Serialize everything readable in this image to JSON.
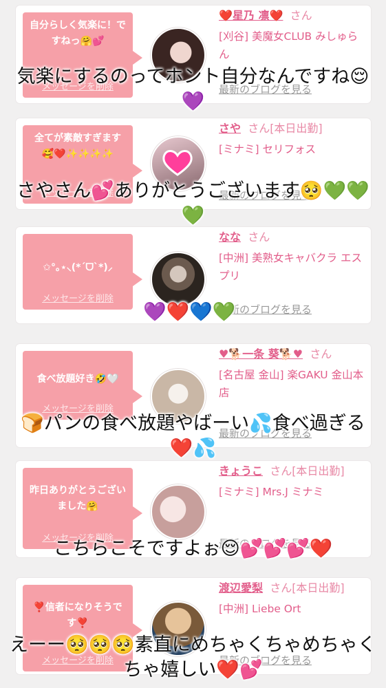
{
  "cards": [
    {
      "message": "自分らしく気楽に！ですねっ🤗💕",
      "delete_label": "メッセージを削除",
      "name": "❤️星乃 凛❤️",
      "honorific": "さん",
      "shop": "[刈谷] 美魔女CLUB みしゅらん",
      "blog_link": "最新のブログを見る",
      "avatar_colors": [
        "#e9ccc4",
        "#3a2522"
      ]
    },
    {
      "message": "全てが素敵すぎます🥰❤️✨✨✨✨",
      "delete_label": "メッセージを削除",
      "name": "さや",
      "honorific": "さん[本日出勤]",
      "shop": "[ミナミ] セリフォス",
      "blog_link": "最新のブログを見る",
      "avatar_colors": [
        "#d9b8c0",
        "#8a6a70"
      ]
    },
    {
      "message": "✩°｡⋆⸜(*ˊᗜˋ*)⸝",
      "delete_label": "メッセージを削除",
      "name": "なな",
      "honorific": "さん",
      "shop": "[中洲] 美熟女キャバクラ エスプリ",
      "blog_link": "最新のブログを見る",
      "avatar_colors": [
        "#d4c7bd",
        "#2b241f"
      ]
    },
    {
      "message": "食べ放題好き🤣🤍",
      "delete_label": "メッセージを削除",
      "name": "♥🐕一条 葵🐕♥",
      "honorific": "さん",
      "shop": "[名古屋 金山] 楽GAKU 金山本店",
      "blog_link": "最新のブログを見る",
      "avatar_colors": [
        "#f2ede8",
        "#c9b7a6"
      ]
    },
    {
      "message": "昨日ありがとうございました🤗",
      "delete_label": "メッセージを削除",
      "name": "きょうこ",
      "honorific": "さん[本日出勤]",
      "shop": "[ミナミ] Mrs.J ミナミ",
      "blog_link": "最新のブログを見る",
      "avatar_colors": [
        "#f3dcdb",
        "#c79f9c"
      ]
    },
    {
      "message": "❣️信者になりそうです❣️",
      "delete_label": "メッセージを削除",
      "name": "渡辺愛梨",
      "honorific": "さん[本日出勤]",
      "shop": "[中洲] Liebe Ort",
      "blog_link": "最新のブログを見る",
      "avatar_colors": [
        "#e6c39a",
        "#274363"
      ]
    }
  ],
  "captions": [
    "気楽にするのってホント自分なんですね😌💜",
    "さやさん💕ありがとうございます🥺💚💚💚",
    "💜❤️💙💚",
    "🍞パンの食べ放題やばーい💦食べ過ぎる❤️💦",
    "こちらこそですよぉ😌💕💕💕❤️",
    "えーー🥺🥺🥺素直にめちゃくちゃめちゃくちゃ嬉しい❤️💕"
  ],
  "colors": {
    "bubble": "#f6a0a8",
    "name_pink": "#e25d8a",
    "background": "#f1f0f0"
  }
}
